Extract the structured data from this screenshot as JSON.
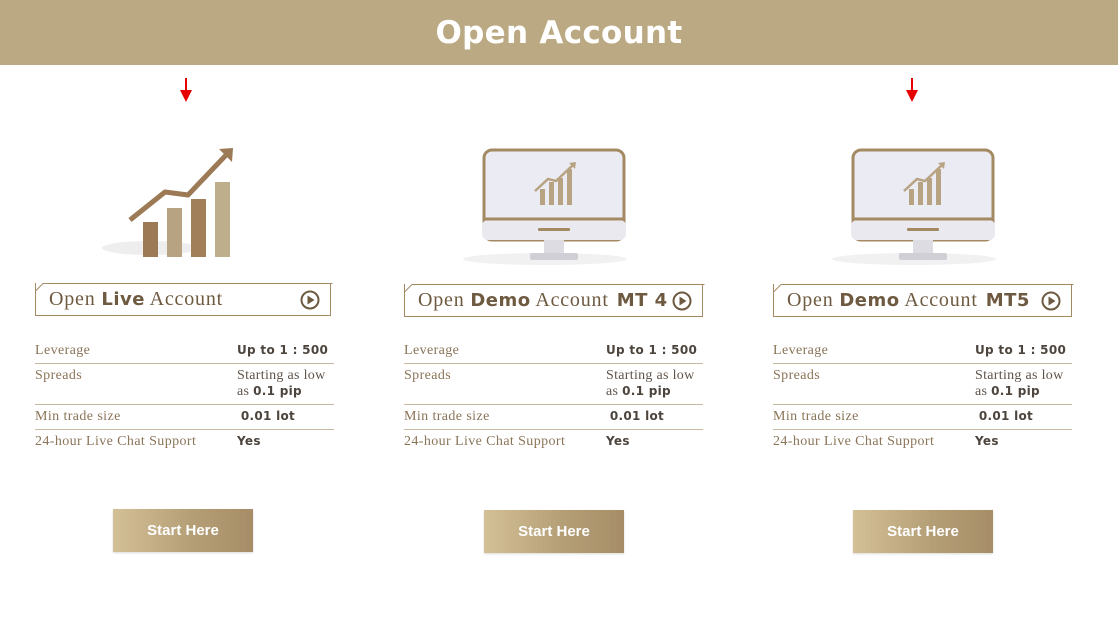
{
  "header": {
    "title": "Open Account"
  },
  "colors": {
    "banner": "#baa982",
    "brand_brown": "#a48a63",
    "arrow": "#e60000"
  },
  "columns": [
    {
      "icon": "growth-chart-icon",
      "heading": {
        "prefix": "Open",
        "strong": "Live",
        "suffix": "Account",
        "platform": ""
      },
      "rows": [
        {
          "label": "Leverage",
          "value": "Up to 1 : 500"
        },
        {
          "label": "Spreads",
          "value_prefix": "Starting as low as",
          "value_strong": "0.1 pip"
        },
        {
          "label": "Min trade size",
          "value": "0.01 lot"
        },
        {
          "label": "24-hour Live Chat Support",
          "value": "Yes"
        }
      ],
      "button": "Start Here"
    },
    {
      "icon": "monitor-chart-icon",
      "heading": {
        "prefix": "Open",
        "strong": "Demo",
        "suffix": "Account",
        "platform": "MT 4"
      },
      "rows": [
        {
          "label": "Leverage",
          "value": "Up to 1 : 500"
        },
        {
          "label": "Spreads",
          "value_prefix": "Starting as low as",
          "value_strong": "0.1 pip"
        },
        {
          "label": "Min trade size",
          "value": "0.01 lot"
        },
        {
          "label": "24-hour Live Chat Support",
          "value": "Yes"
        }
      ],
      "button": "Start Here"
    },
    {
      "icon": "monitor-chart-icon",
      "heading": {
        "prefix": "Open",
        "strong": "Demo",
        "suffix": "Account",
        "platform": "MT5"
      },
      "rows": [
        {
          "label": "Leverage",
          "value": "Up to 1 : 500"
        },
        {
          "label": "Spreads",
          "value_prefix": "Starting as low as",
          "value_strong": "0.1 pip"
        },
        {
          "label": "Min trade size",
          "value": "0.01 lot"
        },
        {
          "label": "24-hour Live Chat Support",
          "value": "Yes"
        }
      ],
      "button": "Start Here"
    }
  ]
}
